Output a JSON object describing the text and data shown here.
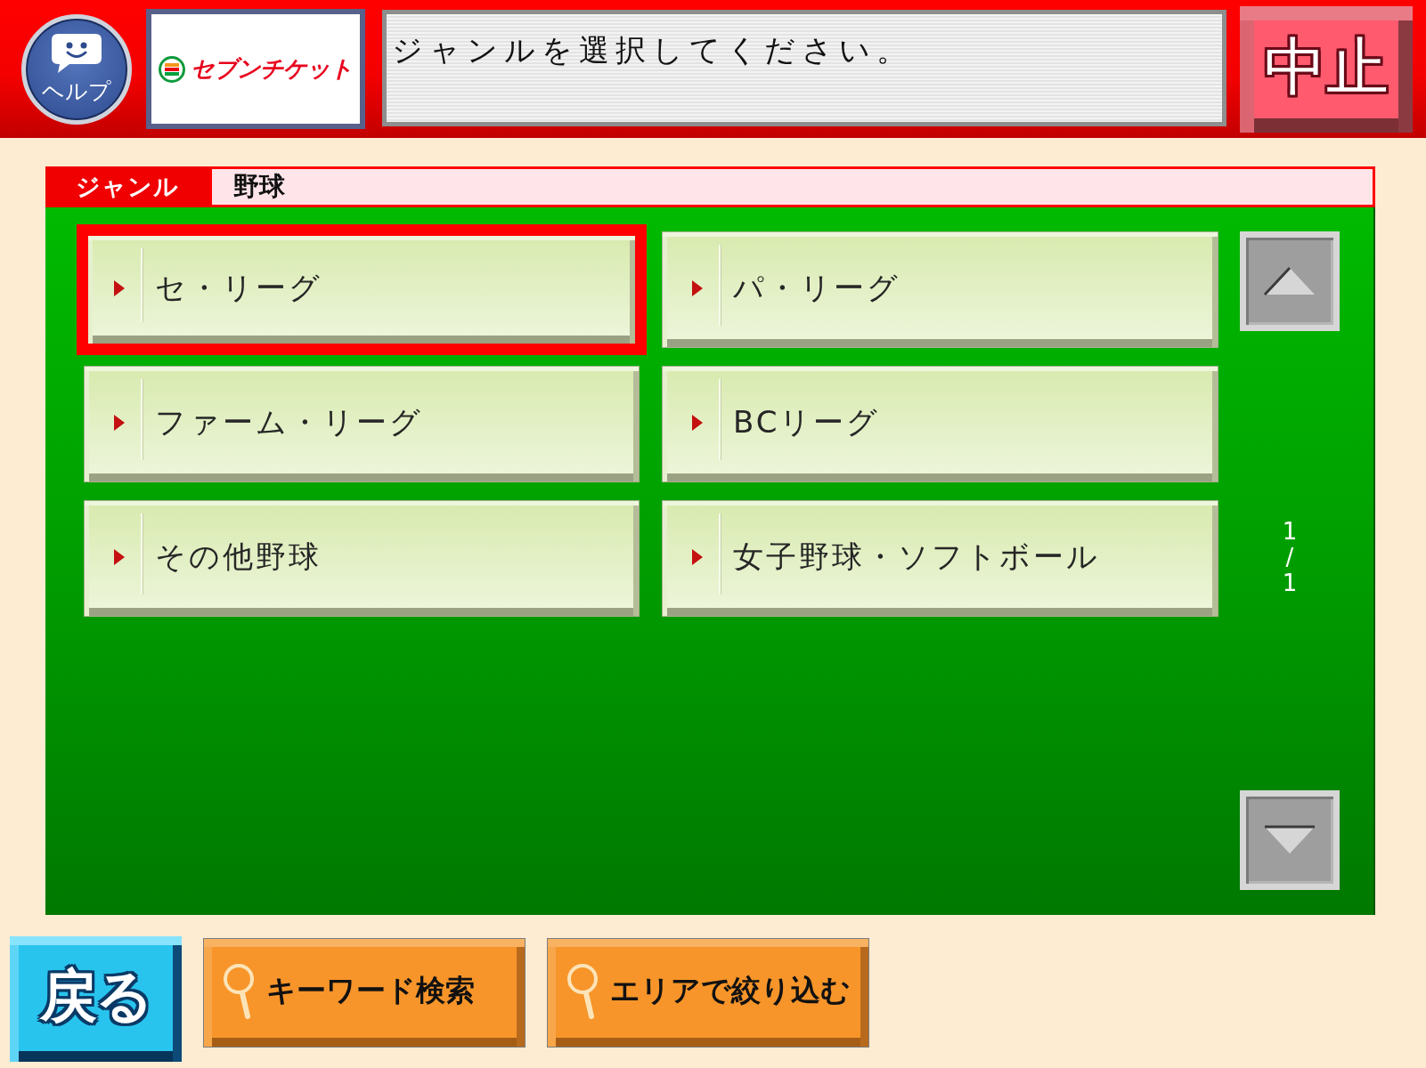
{
  "header": {
    "help_button": {
      "label": "ヘルプ"
    },
    "logo": {
      "text": "セブンチケット"
    },
    "message": "ジャンルを選択してください。",
    "cancel_button": {
      "label": "中止"
    }
  },
  "genre_bar": {
    "label": "ジャンル",
    "value": "野球"
  },
  "genre_buttons": [
    {
      "label": "セ・リーグ",
      "selected": true
    },
    {
      "label": "パ・リーグ",
      "selected": false
    },
    {
      "label": "ファーム・リーグ",
      "selected": false
    },
    {
      "label": "BCリーグ",
      "selected": false
    },
    {
      "label": "その他野球",
      "selected": false
    },
    {
      "label": "女子野球・ソフトボール",
      "selected": false
    }
  ],
  "pager": {
    "current": "1",
    "separator": "/",
    "total": "1"
  },
  "footer_buttons": [
    {
      "kind": "back",
      "label": "戻る"
    },
    {
      "kind": "search",
      "label": "キーワード検索"
    },
    {
      "kind": "search",
      "label": "エリアで絞り込む"
    }
  ]
}
